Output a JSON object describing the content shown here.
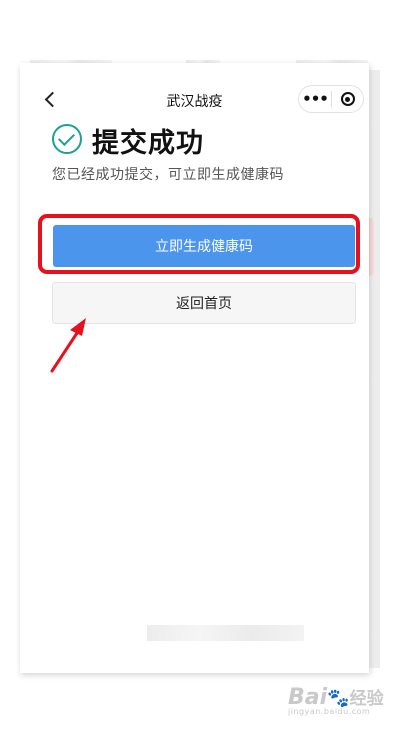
{
  "nav": {
    "title": "武汉战疫",
    "more_glyph": "•••"
  },
  "result": {
    "title": "提交成功",
    "subtitle": "您已经成功提交，可立即生成健康码"
  },
  "actions": {
    "primary_label": "立即生成健康码",
    "secondary_label": "返回首页"
  },
  "annotation": {
    "highlight_color": "#e8101c",
    "arrow_color": "#e8101c"
  },
  "watermark": {
    "brand": "Bai",
    "brand_suffix": "经验",
    "url": "jingyan.baidu.com"
  },
  "colors": {
    "accent": "#4b95ed",
    "success": "#1aa38d"
  }
}
